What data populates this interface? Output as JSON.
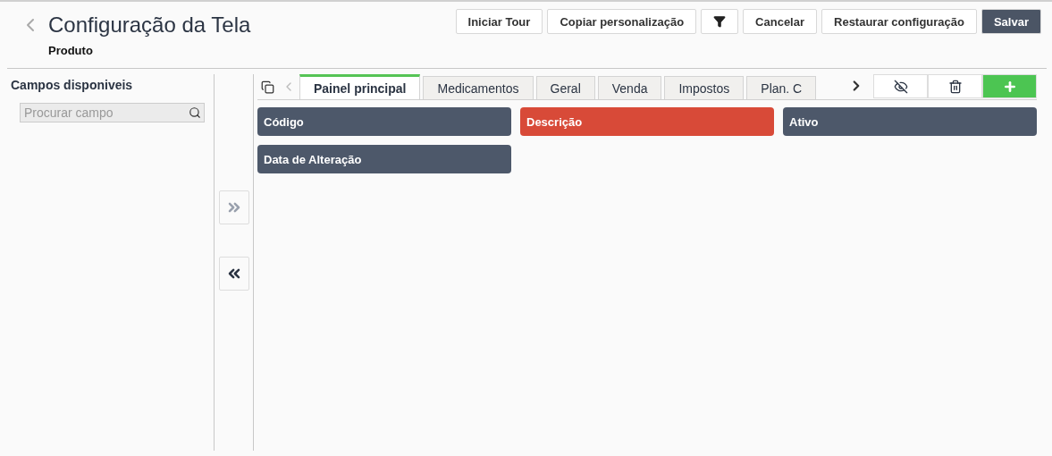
{
  "header": {
    "title": "Configuração da Tela",
    "subtitle": "Produto"
  },
  "toolbar": [
    {
      "kind": "text",
      "label": "Iniciar Tour"
    },
    {
      "kind": "text",
      "label": "Copiar personalização"
    },
    {
      "kind": "filter"
    },
    {
      "kind": "text",
      "label": "Cancelar"
    },
    {
      "kind": "text",
      "label": "Restaurar configuração"
    },
    {
      "kind": "primary",
      "label": "Salvar"
    }
  ],
  "available_fields": {
    "title": "Campos disponiveis",
    "search": {
      "placeholder": "Procurar campo"
    }
  },
  "move_buttons": [
    {
      "kind": "add",
      "disabled": true
    },
    {
      "kind": "remove",
      "disabled": false
    }
  ],
  "tabs": [
    {
      "label": "Painel principal",
      "selected": true
    },
    {
      "label": "Medicamentos",
      "selected": false
    },
    {
      "label": "Geral",
      "selected": false
    },
    {
      "label": "Venda",
      "selected": false
    },
    {
      "label": "Impostos",
      "selected": false
    },
    {
      "label": "Plan. C",
      "selected": false
    }
  ],
  "fields": [
    {
      "label": "Código",
      "selected": false
    },
    {
      "label": "Descrição",
      "selected": true
    },
    {
      "label": "Ativo",
      "selected": false
    },
    {
      "label": "Data de Alteração",
      "selected": false
    }
  ]
}
